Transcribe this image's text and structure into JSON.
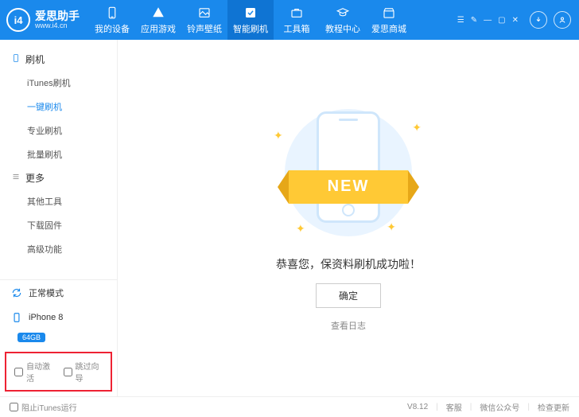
{
  "brand": {
    "logo": "i4",
    "title": "爱思助手",
    "url": "www.i4.cn"
  },
  "nav": [
    {
      "key": "device",
      "label": "我的设备"
    },
    {
      "key": "apps",
      "label": "应用游戏"
    },
    {
      "key": "ringwall",
      "label": "铃声壁纸"
    },
    {
      "key": "flash",
      "label": "智能刷机",
      "active": true
    },
    {
      "key": "toolbox",
      "label": "工具箱"
    },
    {
      "key": "tutorial",
      "label": "教程中心"
    },
    {
      "key": "mall",
      "label": "爱思商城"
    }
  ],
  "sidebar": {
    "section1": {
      "title": "刷机",
      "items": [
        {
          "key": "itunes",
          "label": "iTunes刷机"
        },
        {
          "key": "oneclick",
          "label": "一键刷机",
          "active": true
        },
        {
          "key": "pro",
          "label": "专业刷机"
        },
        {
          "key": "batch",
          "label": "批量刷机"
        }
      ]
    },
    "section2": {
      "title": "更多",
      "items": [
        {
          "key": "othertools",
          "label": "其他工具"
        },
        {
          "key": "firmware",
          "label": "下载固件"
        },
        {
          "key": "advanced",
          "label": "高级功能"
        }
      ]
    },
    "mode": "正常模式",
    "device_name": "iPhone 8",
    "device_badge": "64GB",
    "auto_activate": "自动激活",
    "skip_guide": "跳过向导"
  },
  "main": {
    "ribbon": "NEW",
    "message": "恭喜您，保资料刷机成功啦！",
    "ok": "确定",
    "viewlog": "查看日志"
  },
  "footer": {
    "block_itunes": "阻止iTunes运行",
    "version": "V8.12",
    "support": "客服",
    "wechat": "微信公众号",
    "update": "检查更新"
  }
}
